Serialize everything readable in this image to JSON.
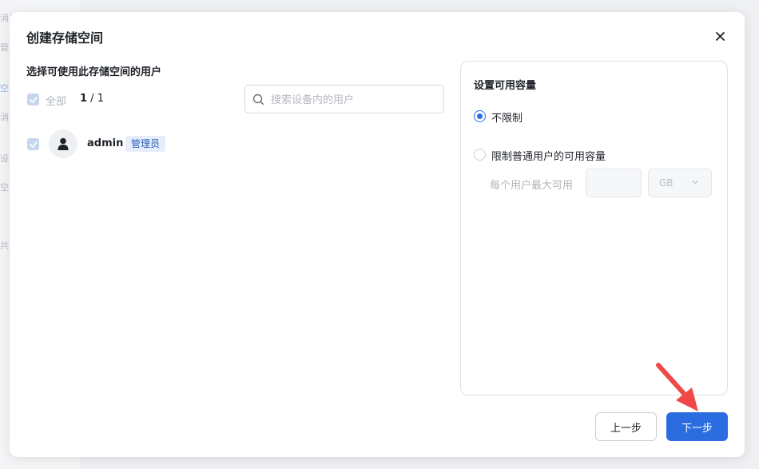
{
  "background": {
    "side_items": [
      "消息",
      "管理",
      "空间",
      "消息",
      "设置",
      "空间",
      "共享"
    ]
  },
  "dialog": {
    "title": "创建存储空间",
    "close_icon": "close-icon"
  },
  "users": {
    "section_title": "选择可使用此存储空间的用户",
    "select_all_label": "全部",
    "selected_count": "1",
    "count_separator": " / ",
    "total_count": "1",
    "search_placeholder": "搜索设备内的用户",
    "list": [
      {
        "name": "admin",
        "badge": "管理员",
        "checked": true
      }
    ]
  },
  "capacity": {
    "title": "设置可用容量",
    "option_unlimited": "不限制",
    "option_limit": "限制普通用户的可用容量",
    "selected": "unlimited",
    "per_user_label": "每个用户最大可用",
    "per_user_value": "",
    "unit": "GB"
  },
  "footer": {
    "prev_label": "上一步",
    "next_label": "下一步"
  },
  "colors": {
    "accent": "#2b6de0",
    "annotation_arrow": "#f04848",
    "badge_bg": "#e6eefb",
    "checkbox_disabled": "#c7d6ef"
  }
}
